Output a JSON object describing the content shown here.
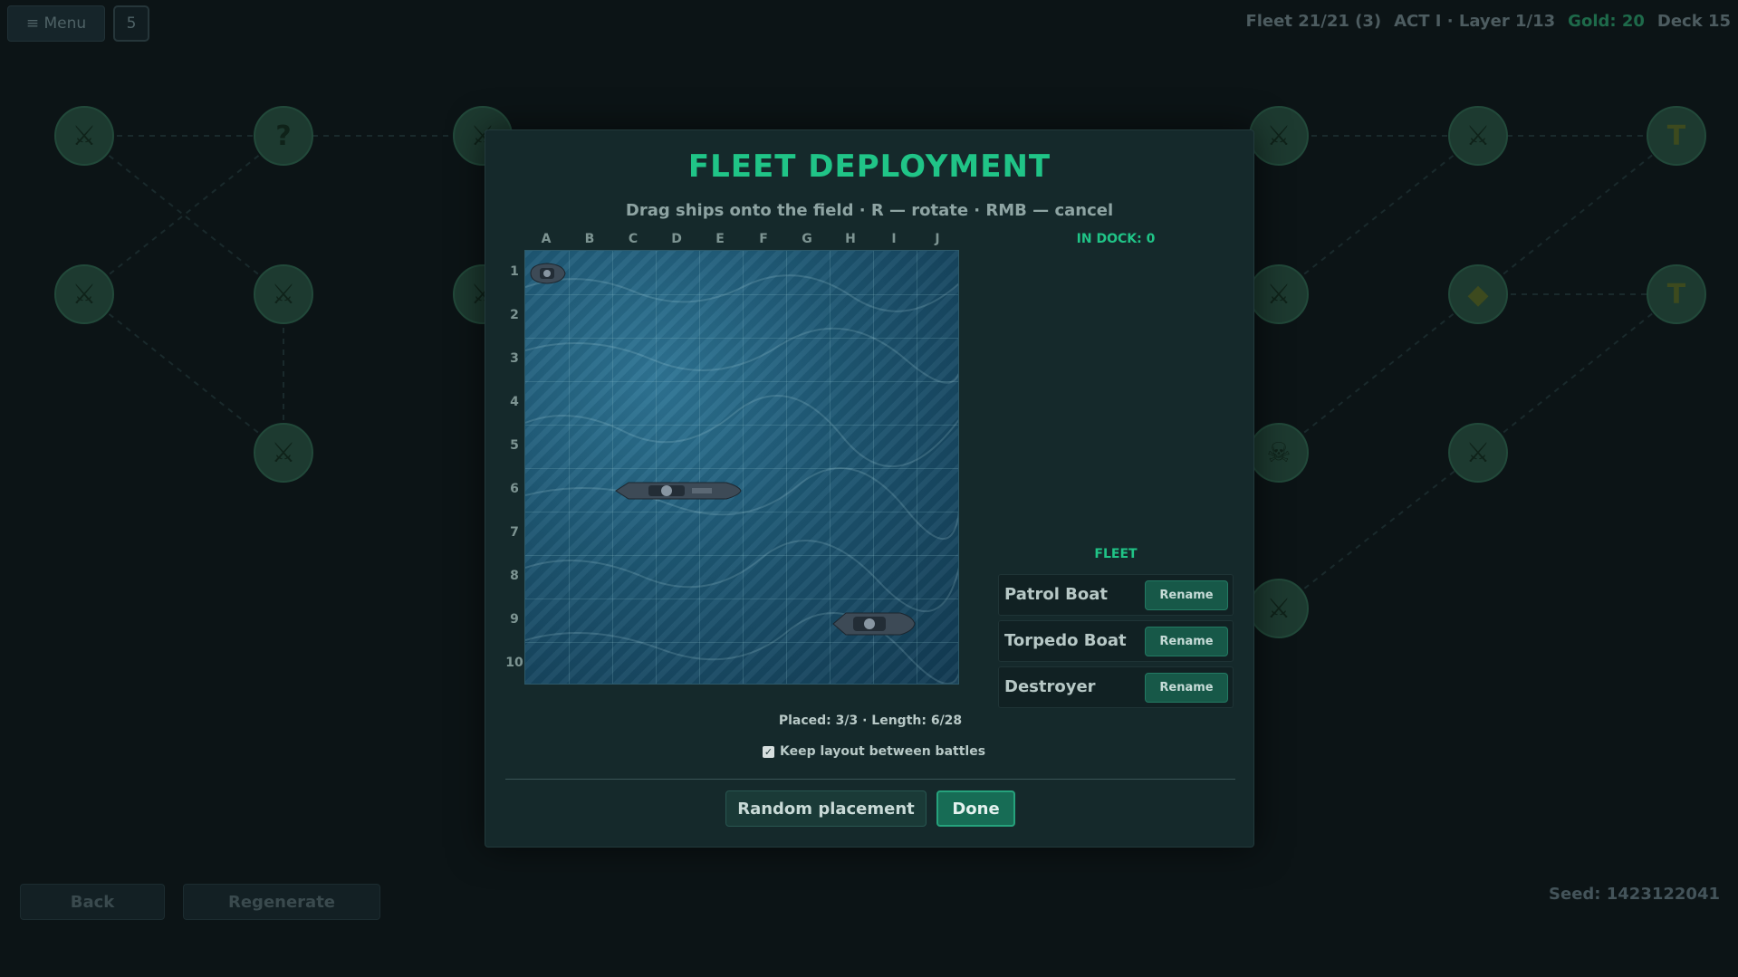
{
  "topbar": {
    "menu_label": "≡ Menu",
    "count": "5",
    "fleet": "Fleet 21/21 (3)",
    "act": "ACT I · Layer 1/13",
    "gold": "Gold: 20",
    "deck": "Deck 15"
  },
  "map": {
    "node_icons": [
      "crossed-swords-icon",
      "question-icon",
      "treasure-icon",
      "skull-icon",
      "shop-icon"
    ]
  },
  "bottom": {
    "back_label": "Back",
    "regenerate_label": "Regenerate",
    "seed": "Seed: 1423122041"
  },
  "modal": {
    "title": "FLEET DEPLOYMENT",
    "subtitle": "Drag ships onto the field · R — rotate · RMB — cancel",
    "columns": [
      "A",
      "B",
      "C",
      "D",
      "E",
      "F",
      "G",
      "H",
      "I",
      "J"
    ],
    "rows": [
      "1",
      "2",
      "3",
      "4",
      "5",
      "6",
      "7",
      "8",
      "9",
      "10"
    ],
    "dock_label": "IN DOCK: 0",
    "fleet_label": "FLEET",
    "fleet": [
      {
        "name": "Patrol Boat",
        "action": "Rename"
      },
      {
        "name": "Torpedo Boat",
        "action": "Rename"
      },
      {
        "name": "Destroyer",
        "action": "Rename"
      }
    ],
    "placed_info": "Placed: 3/3 · Length: 6/28",
    "keep_layout_label": "Keep layout between battles",
    "keep_layout_checked": true,
    "random_label": "Random placement",
    "done_label": "Done"
  },
  "colors": {
    "accent": "#20c487",
    "background": "#0c1416",
    "modal": "#15292b",
    "water": "#1d5672"
  }
}
